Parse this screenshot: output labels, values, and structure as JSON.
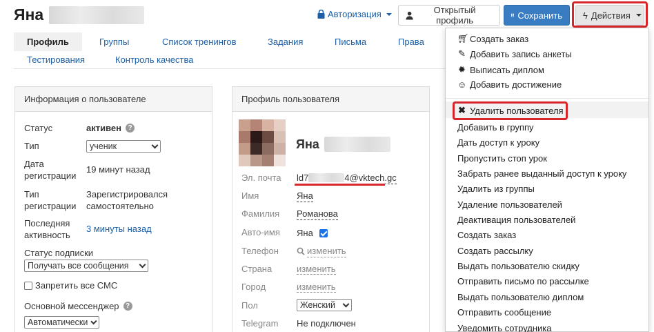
{
  "header": {
    "user_first_name": "Яна",
    "auth_link": "Авторизация",
    "open_profile_button": "Открытый профиль",
    "save_button": "Сохранить",
    "actions_button": "Действия"
  },
  "tabs": [
    "Профиль",
    "Группы",
    "Список тренингов",
    "Задания",
    "Письма",
    "Права",
    "Тестирования",
    "Контроль качества"
  ],
  "user_info": {
    "title": "Информация о пользователе",
    "status_label": "Статус",
    "status_value": "активен",
    "type_label": "Тип",
    "type_value": "ученик",
    "reg_date_label": "Дата регистрации",
    "reg_date_value": "19 минут назад",
    "reg_type_label": "Тип регистрации",
    "reg_type_value": "Зарегистрировался самостоятельно",
    "last_activity_label": "Последняя активность",
    "last_activity_value": "3 минуты назад",
    "subscription_label": "Статус подписки",
    "subscription_value": "Получать все сообщения",
    "sms_label": "Запретить все СМС",
    "messenger_label": "Основной мессенджер",
    "messenger_value": "Автоматически"
  },
  "profile": {
    "title": "Профиль пользователя",
    "name": "Яна",
    "email_label": "Эл. почта",
    "email_start": "ld7",
    "email_end": "4@vktech.gc",
    "first_name_label": "Имя",
    "first_name_value": "Яна",
    "last_name_label": "Фамилия",
    "last_name_value": "Романова",
    "auto_name_label": "Авто-имя",
    "auto_name_value": "Яна",
    "phone_label": "Телефон",
    "phone_value": "изменить",
    "country_label": "Страна",
    "country_value": "изменить",
    "city_label": "Город",
    "city_value": "изменить",
    "gender_label": "Пол",
    "gender_value": "Женский",
    "telegram_label": "Telegram",
    "telegram_value": "Не подключен"
  },
  "actions_menu": {
    "top_items": [
      {
        "label": "Создать заказ",
        "icon": "cart-icon"
      },
      {
        "label": "Добавить запись анкеты",
        "icon": "pencil-icon"
      },
      {
        "label": "Выписать диплом",
        "icon": "certificate-icon"
      },
      {
        "label": "Добавить достижение",
        "icon": "smile-icon"
      }
    ],
    "delete_user": "Удалить пользователя",
    "items": [
      "Добавить в группу",
      "Дать доступ к уроку",
      "Пропустить стоп урок",
      "Забрать ранее выданный доступ к уроку",
      "Удалить из группы",
      "Удаление пользователей",
      "Деактивация пользователей",
      "Создать заказ",
      "Создать рассылку",
      "Выдать пользователю скидку",
      "Отправить письмо по рассылке",
      "Выдать пользователю диплом",
      "Отправить сообщение",
      "Уведомить сотрудника"
    ]
  },
  "colors": {
    "link": "#1a5fa8",
    "primary": "#3a7cc2",
    "highlight": "#d8242b"
  }
}
